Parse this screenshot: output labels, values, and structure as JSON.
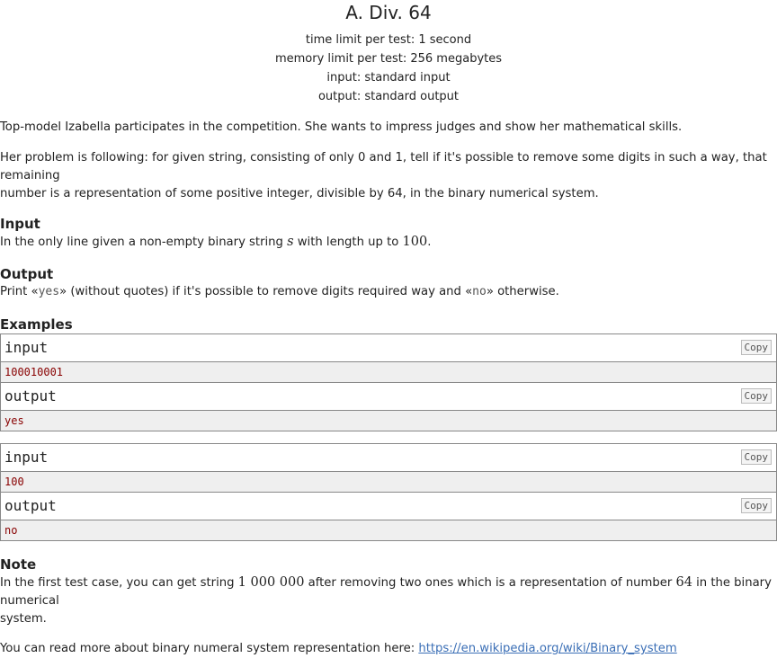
{
  "problem": {
    "title": "A. Div. 64",
    "time_limit": "time limit per test: 1 second",
    "memory_limit": "memory limit per test: 256 megabytes",
    "input_file": "input: standard input",
    "output_file": "output: standard output"
  },
  "statement": {
    "p1": "Top-model Izabella participates in the competition. She wants to impress judges and show her mathematical skills.",
    "p2_line1": "Her problem is following: for given string, consisting of only 0 and 1, tell if it's possible to remove some digits in such a way, that remaining",
    "p2_line2": "number is a representation of some positive integer, divisible by 64, in the binary numerical system."
  },
  "input_section": {
    "title": "Input",
    "text_a": "In the only line given a non-empty binary string ",
    "var_s": "s",
    "text_b": " with length up to ",
    "num_100": "100",
    "text_c": "."
  },
  "output_section": {
    "title": "Output",
    "text_a": "Print «",
    "yes": "yes",
    "text_b": "» (without quotes) if it's possible to remove digits required way and «",
    "no": "no",
    "text_c": "» otherwise."
  },
  "examples": {
    "title": "Examples",
    "copy_label": "Copy",
    "input_label": "input",
    "output_label": "output",
    "tests": [
      {
        "input": "100010001",
        "output": "yes"
      },
      {
        "input": "100",
        "output": "no"
      }
    ]
  },
  "note": {
    "title": "Note",
    "line1_a": "In the first test case, you can get string ",
    "line1_math": "1 000 000",
    "line1_b": " after removing two ones which is a representation of number ",
    "line1_num": "64",
    "line1_c": " in the binary numerical",
    "line2": "system.",
    "line3_a": "You can read more about binary numeral system representation here: ",
    "link": "https://en.wikipedia.org/wiki/Binary_system"
  }
}
